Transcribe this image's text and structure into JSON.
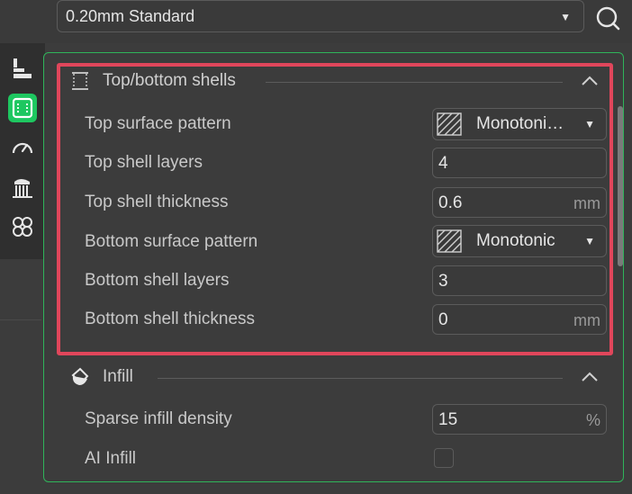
{
  "preset": {
    "value": "0.20mm Standard"
  },
  "icons": {
    "search": "search-icon",
    "rail": [
      "quality-icon",
      "shells-icon",
      "speed-icon",
      "support-icon",
      "others-icon"
    ]
  },
  "colors": {
    "accent": "#1ec760",
    "highlight": "#e0465b",
    "panel_border": "#2fb45a"
  },
  "sections": {
    "top_bottom": {
      "title": "Top/bottom shells",
      "rows": [
        {
          "label": "Top surface pattern",
          "value": "Monotoni…",
          "type": "dropdown"
        },
        {
          "label": "Top shell layers",
          "value": "4",
          "type": "input"
        },
        {
          "label": "Top shell thickness",
          "value": "0.6",
          "unit": "mm",
          "type": "input"
        },
        {
          "label": "Bottom surface pattern",
          "value": "Monotonic",
          "type": "dropdown"
        },
        {
          "label": "Bottom shell layers",
          "value": "3",
          "type": "input"
        },
        {
          "label": "Bottom shell thickness",
          "value": "0",
          "unit": "mm",
          "type": "input"
        }
      ]
    },
    "infill": {
      "title": "Infill",
      "rows": [
        {
          "label": "Sparse infill density",
          "value": "15",
          "unit": "%",
          "type": "input"
        },
        {
          "label": "AI Infill",
          "checked": false,
          "type": "checkbox"
        }
      ]
    }
  }
}
